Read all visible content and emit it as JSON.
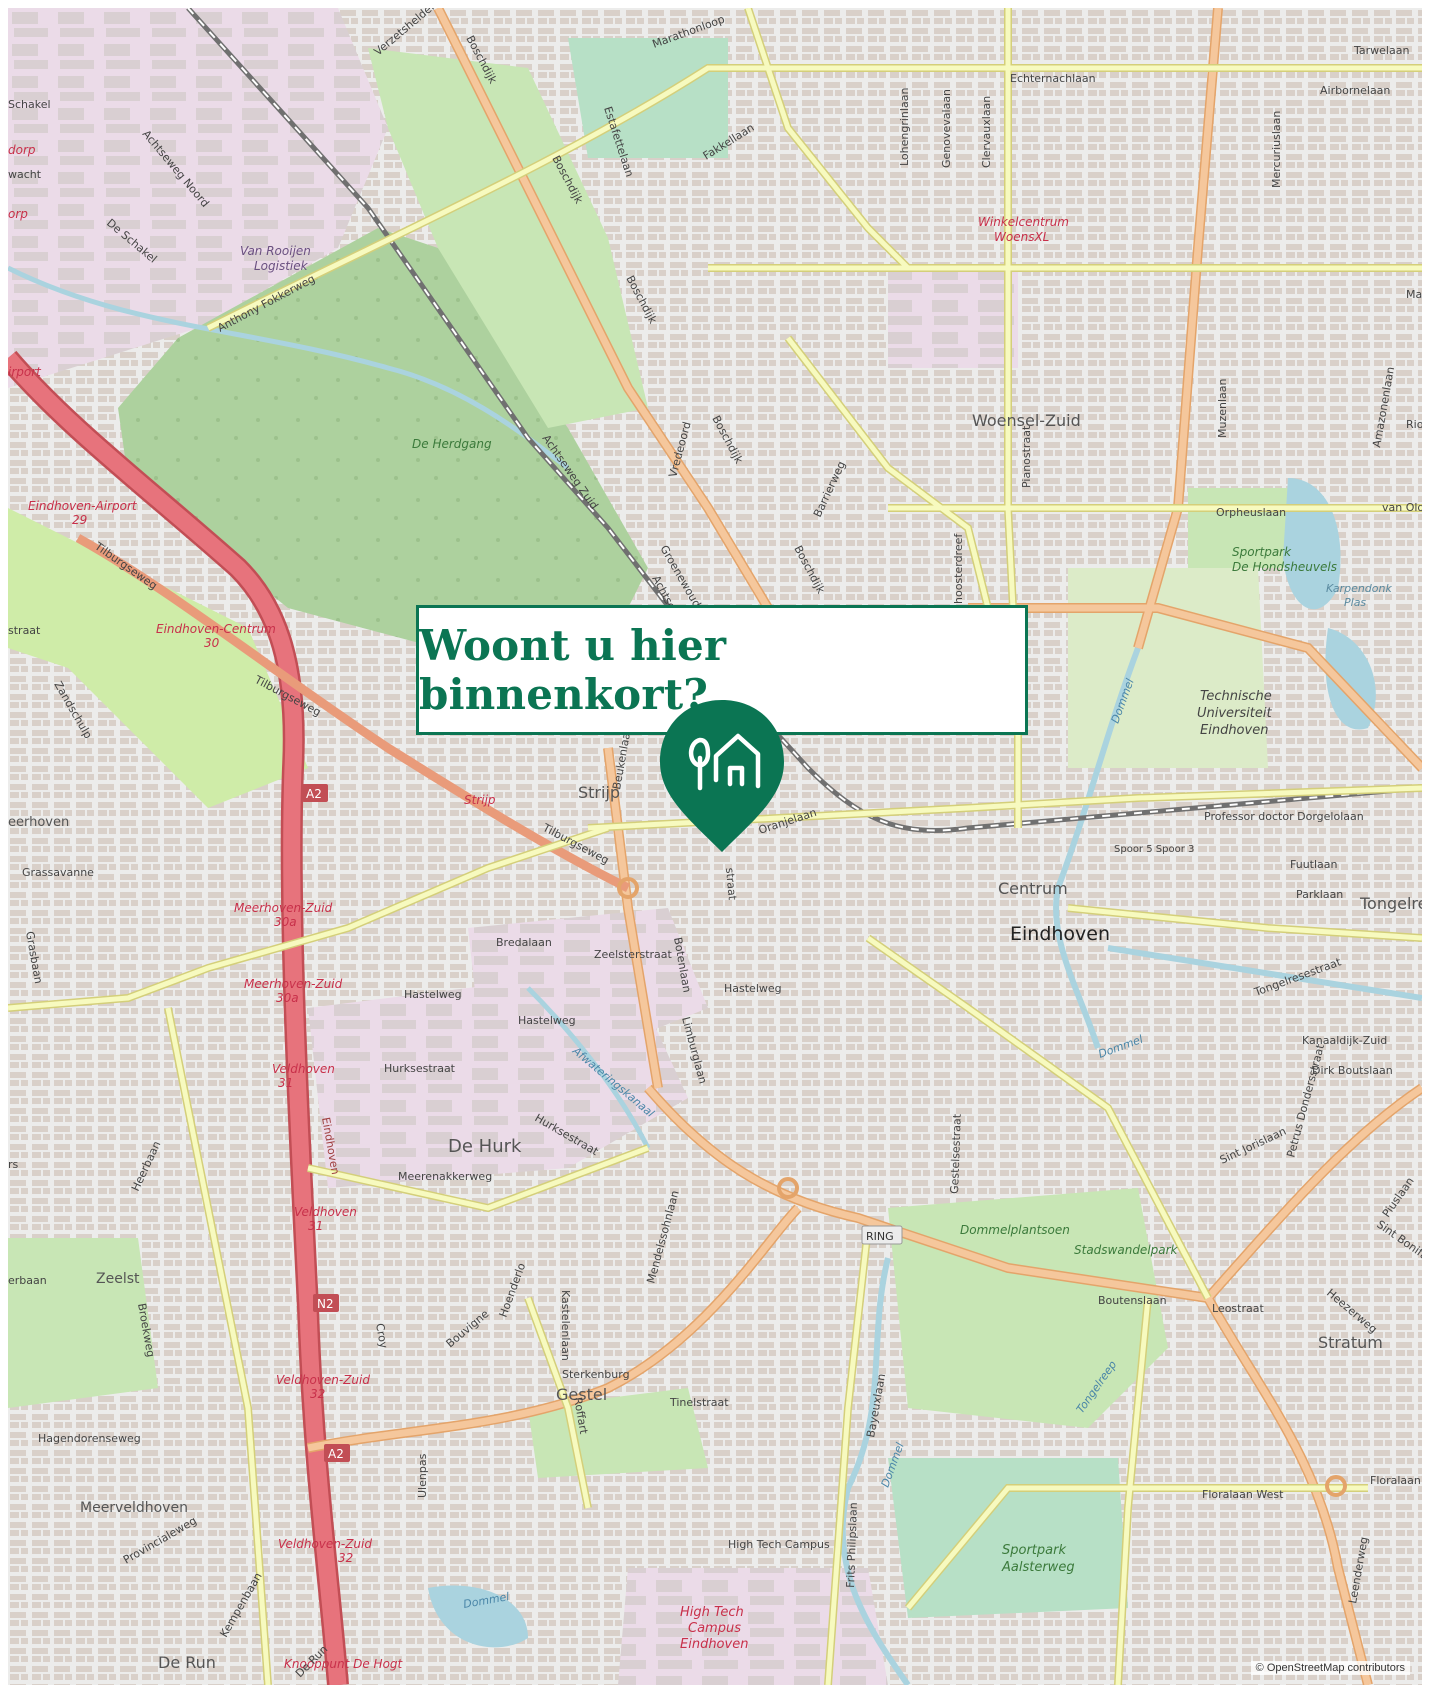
{
  "callout": {
    "title": "Woont u hier binnenkort?"
  },
  "attribution": "© OpenStreetMap contributors",
  "map_labels": {
    "woensel_zuid": "Woensel-Zuid",
    "centrum": "Centrum",
    "eindhoven": "Eindhoven",
    "strijp": "Strijp",
    "de_hurk": "De Hurk",
    "gestel": "Gestel",
    "stratum": "Stratum",
    "zeelst": "Zeelst",
    "meerveldhoven": "Meerveldhoven",
    "de_run": "De Run",
    "tongelre": "Tongelre",
    "eerhoven": "eerhoven",
    "winkelcentrum_1": "Winkelcentrum",
    "winkelcentrum_2": "WoensXL",
    "van_rooijen_1": "Van Rooijen",
    "van_rooijen_2": "Logistiek",
    "de_herdgang": "De Herdgang",
    "tu_1": "Technische",
    "tu_2": "Universiteit",
    "tu_3": "Eindhoven",
    "sportpark_hond_1": "Sportpark",
    "sportpark_hond_2": "De Hondsheuvels",
    "karpendonk_1": "Karpendonk",
    "karpendonk_2": "Plas",
    "dommelplantsoen": "Dommelplantsoen",
    "stadswandelpark": "Stadswandelpark",
    "sportpark_aal_1": "Sportpark",
    "sportpark_aal_2": "Aalsterweg",
    "htc_1": "High Tech",
    "htc_2": "Campus",
    "htc_3": "Eindhoven",
    "airport_exit": "Eindhoven-Airport",
    "airport_exit_no": "29",
    "centrum_exit": "Eindhoven-Centrum",
    "centrum_exit_no": "30",
    "meerhoven_zuid_1": "Meerhoven-Zuid",
    "meerhoven_zuid_1_no": "30a",
    "meerhoven_zuid_2": "Meerhoven-Zuid",
    "meerhoven_zuid_2_no": "30a",
    "veldhoven_1": "Veldhoven",
    "veldhoven_1_no": "31",
    "veldhoven_2": "Veldhoven",
    "veldhoven_2_no": "31",
    "veldhoven_zuid_1": "Veldhoven-Zuid",
    "veldhoven_zuid_1_no": "32",
    "veldhoven_zuid_2": "Veldhoven-Zuid",
    "veldhoven_zuid_2_no": "32",
    "knooppunt": "Knooppunt De Hogt",
    "airport_edge": "irport",
    "dorp_edge": "dorp",
    "orp_edge": "orp",
    "strijp_red": "Strijp",
    "ring": "RING",
    "a2_top": "A2",
    "a2_bottom": "A2",
    "n2": "N2",
    "marathonloop": "Marathonloop",
    "boschdijk_1": "Boschdijk",
    "boschdijk_2": "Boschdijk",
    "boschdijk_3": "Boschdijk",
    "boschdijk_4": "Boschdijk",
    "boschdijk_5": "Boschdijk",
    "estafettelaan": "Estafettelaan",
    "fakkellaan": "Fakkellaan",
    "achtseweg_noord": "Achtseweg Noord",
    "achtseweg_zuid": "Achtseweg Zuid",
    "anthony_fokkerweg": "Anthony Fokkerweg",
    "tilburgseweg_1": "Tilburgseweg",
    "tilburgseweg_2": "Tilburgseweg",
    "tilburgseweg_3": "Tilburgseweg",
    "de_schakel": "De Schakel",
    "schakel": "Schakel",
    "wacht": "wacht",
    "verzetsheldenlaan": "Verzetsheldenlaan",
    "genovevalaan": "Genovevalaan",
    "echternachlaan": "Echternachlaan",
    "lohengrinlaan": "Lohengrinlaan",
    "clervauxlaan": "Clervauxlaan",
    "tarwelaan": "Tarwelaan",
    "airbornelaan": "Airbornelaan",
    "mercuriuslaan": "Mercuriuslaan",
    "muzenlaan": "Muzenlaan",
    "amazonenlaan": "Amazonenlaan",
    "orpheuslaan": "Orpheuslaan",
    "van_ol": "van Old",
    "pianostraat": "Pianostraat",
    "barrierweg": "Barrierweg",
    "vredeoord": "Vredeoord",
    "groenewoud": "Groenewoud",
    "achtse": "Achtse",
    "dommel_1": "Dommel",
    "dommel_2": "Dommel",
    "dommel_3": "Dommel",
    "dommel_4": "Dommel",
    "professor": "Professor doctor Dorgelolaan",
    "fuutlaan": "Fuutlaan",
    "parklaan": "Parklaan",
    "spoor": "Spoor 5  Spoor 3",
    "beukenlaan": "Beukenlaan",
    "oranjelaan": "Oranjelaan",
    "straat": "straat",
    "bredalaan": "Bredalaan",
    "zeelsterstraat": "Zeelsterstraat",
    "botenlaan": "Botenlaan",
    "hastelweg_1": "Hastelweg",
    "hastelweg_2": "Hastelweg",
    "hastelweg_3": "Hastelweg",
    "hurksestraat_1": "Hurksestraat",
    "hurksestraat_2": "Hurksestraat",
    "afwateringskanaal": "Afwateringskanaal",
    "limburglaan": "Limburglaan",
    "meerenakkerweg": "Meerenakkerweg",
    "mendelssohnlaan": "Mendelssohnlaan",
    "gestelsestraat": "Gestelsestraat",
    "tongelresestraat": "Tongelresestraat",
    "kanaaldijk_zuid": "Kanaaldijk-Zuid",
    "dirk_boutslaan": "Dirk Boutslaan",
    "sint_jorislaan": "Sint Jorislaan",
    "petrus": "Petrus Dondersstraat",
    "piuslaan": "Piuslaan",
    "sint_bonifacius": "Sint Bonifac",
    "heezerweg": "Heezerweg",
    "boutenslaan": "Boutenslaan",
    "leostraat": "Leostraat",
    "floralaan_west": "Floralaan West",
    "tongelreep": "Tongelreep",
    "bayeuxlaan": "Bayeuxlaan",
    "high_tech_campus_rd": "High Tech Campus",
    "tinelstraat": "Tinelstraat",
    "kastelenlaan": "Kastelenlaan",
    "roffart": "Roffart",
    "sterkenburg": "Sterkenburg",
    "bouvigne": "Bouvigne",
    "hoenderlo": "Hoenderlo",
    "croy": "Croy",
    "ulenpas": "Ulenpas",
    "hagendorenseweg": "Hagendorenseweg",
    "provincialeweg": "Provincialeweg",
    "kempenbaan": "Kempenbaan",
    "de_run_rd": "De Run",
    "broekweg": "Broekweg",
    "heerbaan": "Heerbaan",
    "erbaan": "erbaan",
    "grassavanne": "Grassavanne",
    "grasbaan": "Grasbaan",
    "zandschulp": "Zandschulp",
    "straat_edge": "straat",
    "s_edge": "rs",
    "rio_edge": "Rio",
    "ma_edge": "Ma",
    "hoosterdreef": "hoosterdreef",
    "eindhoven_a2": "Eindhoven",
    "floralaan_oost": "Floralaan",
    "leenderweg": "Leenderweg",
    "frits_philipslaan": "Frits Philipslaan"
  },
  "colors": {
    "brand": "#0b7553",
    "water": "#aad3df",
    "park": "#c8e6b5",
    "forest": "#add19e",
    "motorway": "#e7737c",
    "trunk": "#f5c79c",
    "industrial": "#e8d6e2",
    "residential": "#e0dfdf"
  },
  "icons": {
    "pin": "location-pin-icon",
    "pin_logo": "tree-house-logo-icon"
  }
}
